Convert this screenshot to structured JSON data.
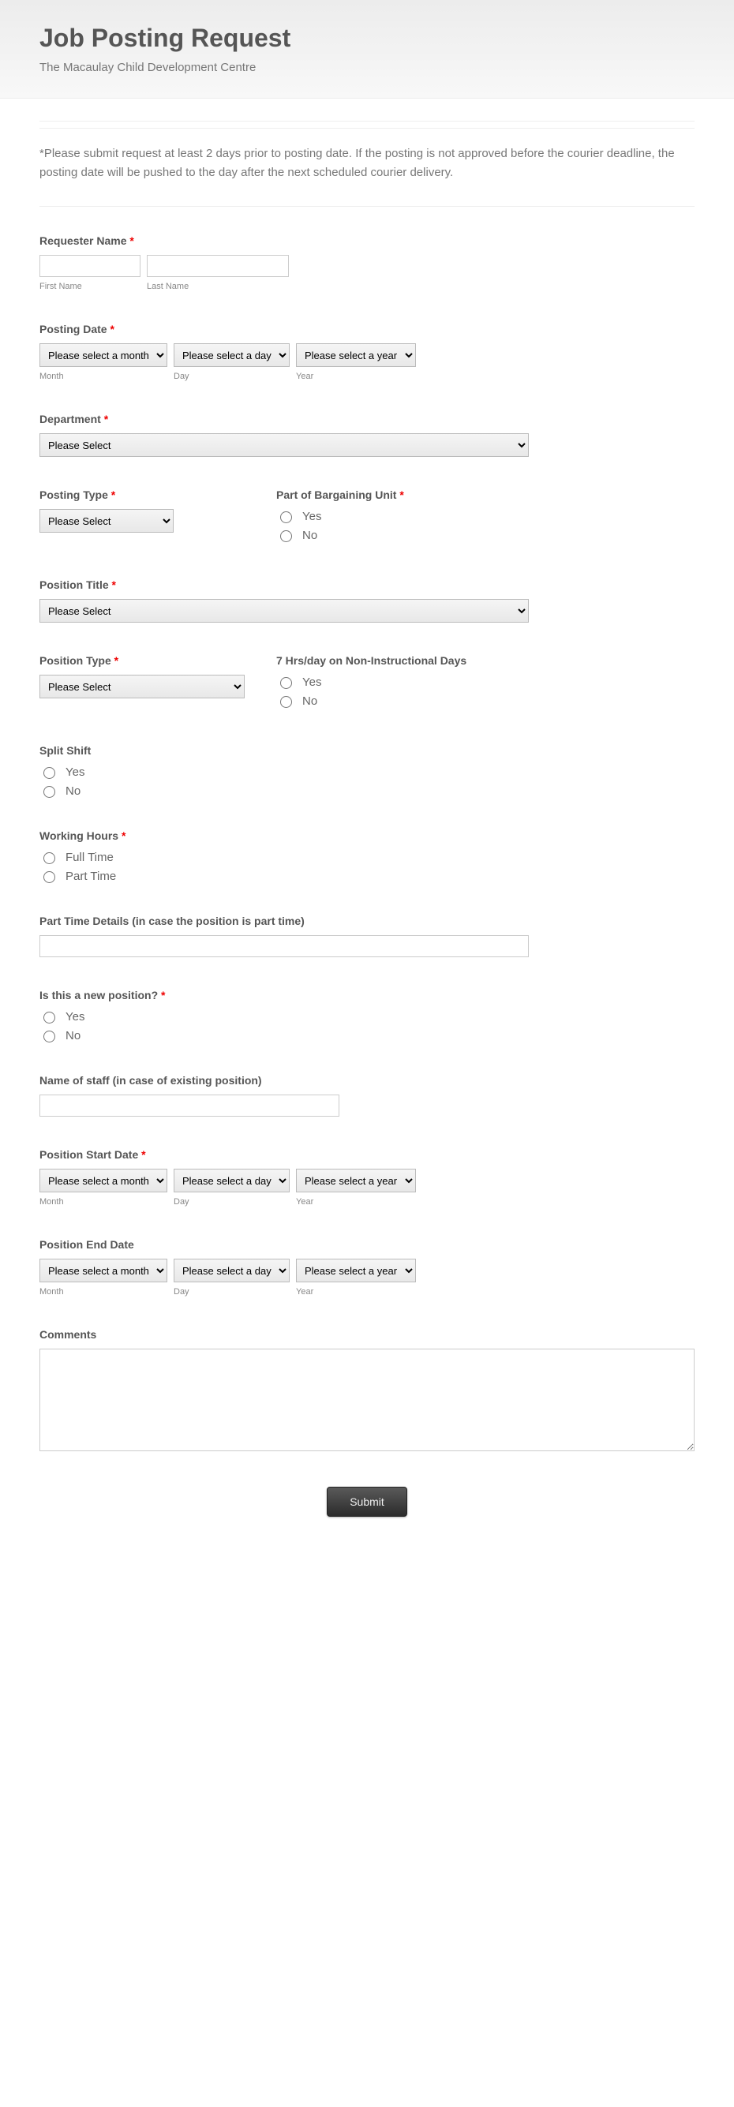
{
  "header": {
    "title": "Job Posting Request",
    "subtitle": "The Macaulay Child Development Centre"
  },
  "intro": "*Please submit request at least 2 days prior to posting date. If the posting is not approved before the courier deadline, the posting date will be pushed to the day after the next scheduled courier delivery.",
  "labels": {
    "requester": "Requester Name",
    "first_name": "First Name",
    "last_name": "Last Name",
    "posting_date": "Posting Date",
    "month": "Month",
    "day": "Day",
    "year": "Year",
    "department": "Department",
    "posting_type": "Posting Type",
    "bargaining": "Part of Bargaining Unit",
    "position_title": "Position Title",
    "position_type": "Position Type",
    "seven_hrs": "7 Hrs/day on Non-Instructional Days",
    "split_shift": "Split Shift",
    "working_hours": "Working Hours",
    "pt_details": "Part Time Details (in case the position is part time)",
    "new_position": "Is this a new position?",
    "staff_name": "Name of staff (in case of existing position)",
    "start_date": "Position Start Date",
    "end_date": "Position End Date",
    "comments": "Comments"
  },
  "options": {
    "yes": "Yes",
    "no": "No",
    "full_time": "Full Time",
    "part_time": "Part Time",
    "please_select": "Please Select",
    "select_month": "Please select a month",
    "select_day": "Please select a day",
    "select_year": "Please select a year"
  },
  "submit": "Submit"
}
